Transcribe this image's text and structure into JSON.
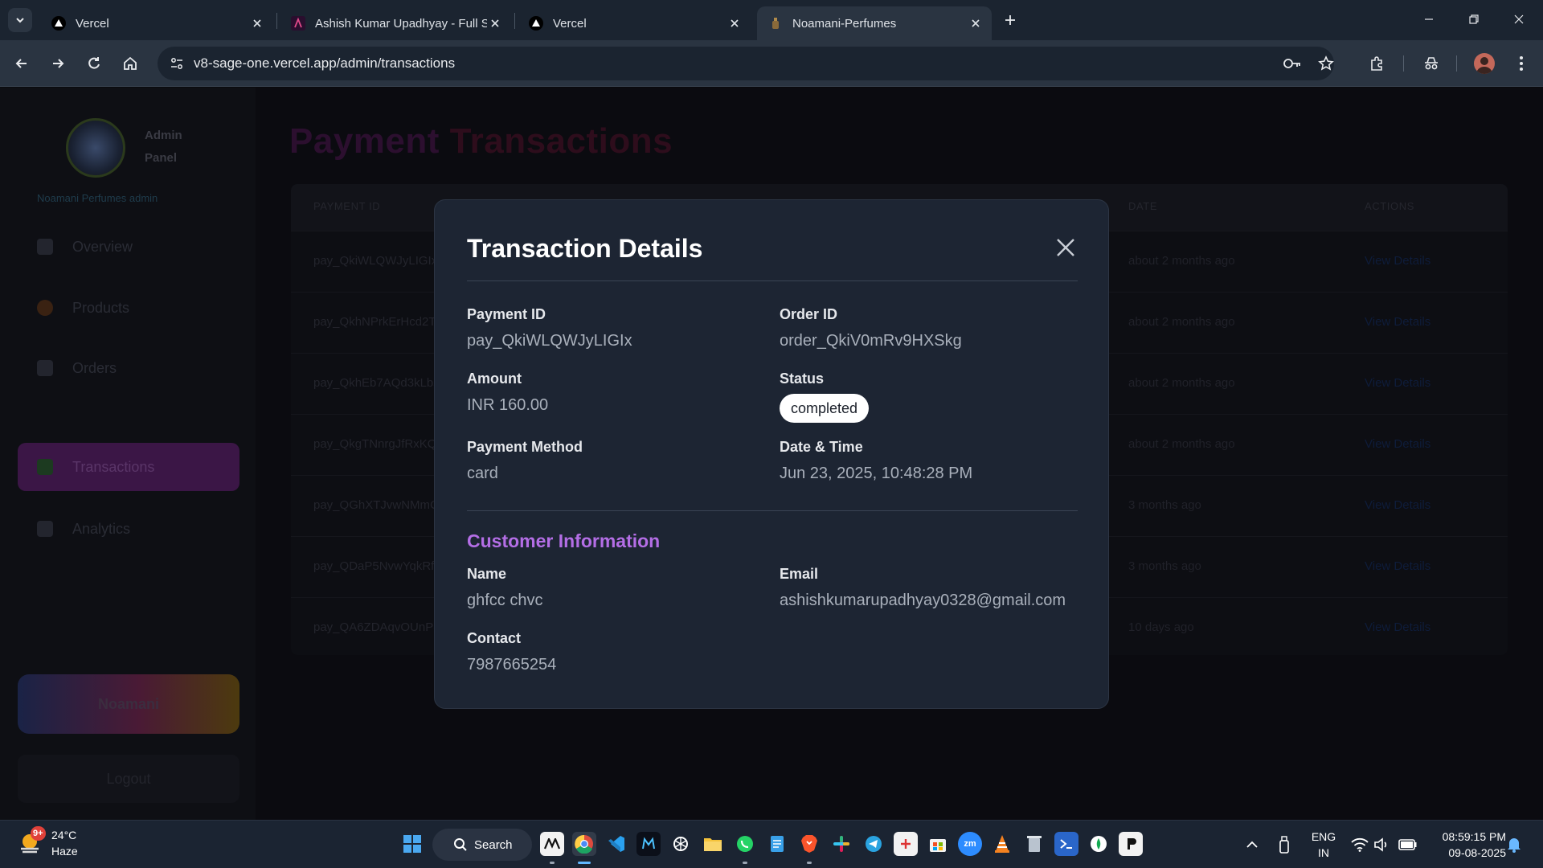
{
  "browser": {
    "tabs": [
      {
        "title": "Vercel",
        "icon": "vercel-triangle-icon"
      },
      {
        "title": "Ashish Kumar Upadhyay - Full S",
        "icon": "portfolio-favicon-icon"
      },
      {
        "title": "Vercel",
        "icon": "vercel-triangle-icon"
      },
      {
        "title": "Noamani-Perfumes",
        "icon": "perfume-favicon-icon"
      }
    ],
    "active_tab_index": 3,
    "url": "v8-sage-one.vercel.app/admin/transactions"
  },
  "sidebar": {
    "brand": "Admin Panel",
    "tagline": "Noamani Perfumes admin",
    "items": [
      {
        "label": "Overview"
      },
      {
        "label": "Products"
      },
      {
        "label": "Orders"
      },
      {
        "label": "Transactions"
      },
      {
        "label": "Analytics"
      }
    ],
    "active_index": 3,
    "promo": "Noamani",
    "logout": "Logout"
  },
  "page": {
    "title_part1": "Payment",
    "title_part2": "Transactions",
    "table": {
      "headers": [
        "PAYMENT ID",
        "DATE",
        "ACTIONS"
      ],
      "rows": [
        {
          "id": "pay_QkiWLQWJyLIGIx",
          "date": "about 2 months ago",
          "action": "View Details"
        },
        {
          "id": "pay_QkhNPrkErHcd2T",
          "date": "about 2 months ago",
          "action": "View Details"
        },
        {
          "id": "pay_QkhEb7AQd3kLbs",
          "date": "about 2 months ago",
          "action": "View Details"
        },
        {
          "id": "pay_QkgTNnrgJfRxKQ",
          "date": "about 2 months ago",
          "action": "View Details"
        },
        {
          "id": "pay_QGhXTJvwNMmCvX",
          "date": "3 months ago",
          "action": "View Details"
        },
        {
          "id": "pay_QDaP5NvwYqkRfp",
          "date": "3 months ago",
          "action": "View Details"
        },
        {
          "id": "pay_QA6ZDAqvOUnP3a",
          "date": "10 days ago",
          "action": "View Details"
        }
      ]
    }
  },
  "modal": {
    "title": "Transaction Details",
    "payment_id_label": "Payment ID",
    "payment_id": "pay_QkiWLQWJyLIGIx",
    "order_id_label": "Order ID",
    "order_id": "order_QkiV0mRv9HXSkg",
    "amount_label": "Amount",
    "amount": "INR 160.00",
    "status_label": "Status",
    "status": "completed",
    "method_label": "Payment Method",
    "method": "card",
    "datetime_label": "Date & Time",
    "datetime": "Jun 23, 2025, 10:48:28 PM",
    "customer_section": "Customer Information",
    "name_label": "Name",
    "name": "ghfcc chvc",
    "email_label": "Email",
    "email": "ashishkumarupadhyay0328@gmail.com",
    "contact_label": "Contact",
    "contact": "7987665254"
  },
  "taskbar": {
    "weather_temp": "24°C",
    "weather_desc": "Haze",
    "weather_badge": "9+",
    "search_label": "Search",
    "lang_top": "ENG",
    "lang_bottom": "IN",
    "time": "08:59:15 PM",
    "date": "09-08-2025"
  },
  "colors": {
    "modal_bg": "#1d2533",
    "accent_purple": "#b46ee6",
    "status_pill": "#ffffff",
    "browser_bar": "#2a3441"
  }
}
